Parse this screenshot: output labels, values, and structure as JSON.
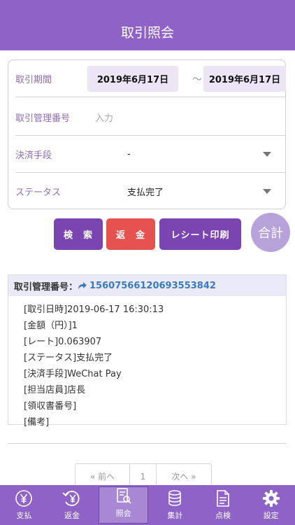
{
  "header": {
    "title": "取引照会"
  },
  "form": {
    "period": {
      "label": "取引期間",
      "from": "2019年6月17日",
      "tilde": "～",
      "to": "2019年6月17日"
    },
    "txn_no": {
      "label": "取引管理番号",
      "placeholder": "入力"
    },
    "payment": {
      "label": "決済手段",
      "value": "-"
    },
    "status": {
      "label": "ステータス",
      "value": "支払完了"
    }
  },
  "buttons": {
    "search": "検　索",
    "refund": "返　金",
    "receipt": "レシート印刷",
    "total": "合計"
  },
  "result": {
    "head_label": "取引管理番号：",
    "head_number": "15607566120693553842",
    "lines": [
      "[取引日時]2019-06-17 16:30:13",
      "[金額（円）]1",
      "[レート]0.063907",
      "[ステータス]支払完了",
      "[決済手段]WeChat Pay",
      "[担当店員]店長",
      "[領収書番号]",
      "[備考]"
    ]
  },
  "pager": {
    "prev": "« 前へ",
    "page": "1",
    "next": "次へ »"
  },
  "tabs": [
    {
      "label": "支払",
      "icon": "yen-circle-icon"
    },
    {
      "label": "返金",
      "icon": "refund-icon"
    },
    {
      "label": "照会",
      "icon": "inquiry-icon"
    },
    {
      "label": "集計",
      "icon": "coins-icon"
    },
    {
      "label": "点検",
      "icon": "document-icon"
    },
    {
      "label": "設定",
      "icon": "gear-icon"
    }
  ],
  "colors": {
    "primary": "#8e62c7",
    "button_purple": "#7a45b0",
    "button_red": "#e5524f",
    "label": "#8f6cb8"
  }
}
